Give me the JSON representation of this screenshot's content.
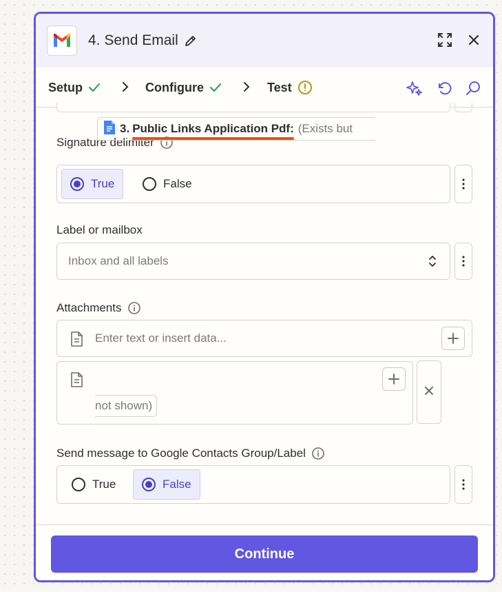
{
  "header": {
    "title": "4. Send Email",
    "app_icon": "gmail-logo",
    "actions": [
      "expand-icon",
      "close-icon"
    ]
  },
  "tabs": [
    {
      "label": "Setup",
      "status": "complete"
    },
    {
      "label": "Configure",
      "status": "complete",
      "active": true
    },
    {
      "label": "Test",
      "status": "warning"
    }
  ],
  "toolbar": [
    "sparkle-icon",
    "undo-icon",
    "search-icon"
  ],
  "fields": {
    "signature_delimiter": {
      "label": "Signature delimiter",
      "options": [
        "True",
        "False"
      ],
      "selected": "True"
    },
    "label_or_mailbox": {
      "label": "Label or mailbox",
      "placeholder": "Inbox and all labels"
    },
    "attachments": {
      "label": "Attachments",
      "placeholder": "Enter text or insert data...",
      "pill_step": "3.",
      "pill_name": "Public Links Application Pdf:",
      "pill_value_line1": "(Exists but",
      "pill_value_line2": "not shown)"
    },
    "contacts_group": {
      "label": "Send message to Google Contacts Group/Label",
      "options": [
        "True",
        "False"
      ],
      "selected": "False"
    }
  },
  "footer": {
    "continue_label": "Continue"
  },
  "colors": {
    "accent": "#6157e0",
    "success": "#1f9d55",
    "warning": "#b8960f",
    "underline": "#e9520e"
  }
}
